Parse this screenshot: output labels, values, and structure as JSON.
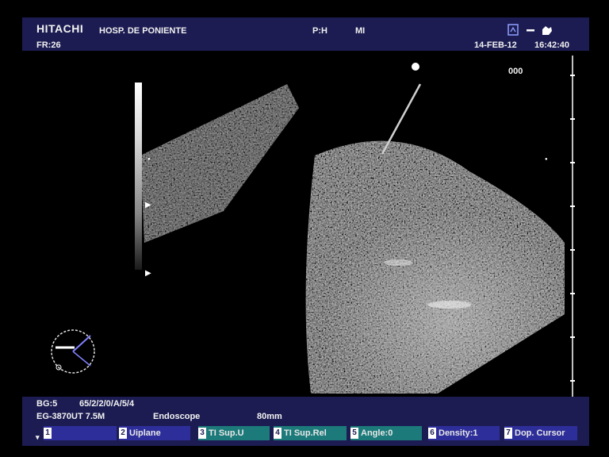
{
  "header": {
    "brand": "HITACHI",
    "hospital": "HOSP. DE PONIENTE",
    "frame_rate": "FR:26",
    "probe_label": "P:H",
    "mi_label": "MI",
    "date": "14-FEB-12",
    "time": "16:42:40",
    "counter": "000"
  },
  "footer": {
    "gain": "BG:5",
    "params": "65/2/2/0/A/5/4",
    "probe": "EG-3870UT 7.5M",
    "mode": "Endoscope",
    "depth": "80mm"
  },
  "function_buttons": [
    {
      "num": "1",
      "label": "",
      "style": "blue"
    },
    {
      "num": "2",
      "label": "Uiplane",
      "style": "blue"
    },
    {
      "num": "3",
      "label": "TI Sup.U",
      "style": "teal"
    },
    {
      "num": "4",
      "label": "TI Sup.Rel",
      "style": "teal"
    },
    {
      "num": "5",
      "label": "Angle:0",
      "style": "teal"
    },
    {
      "num": "6",
      "label": "Density:1",
      "style": "blue"
    },
    {
      "num": "7",
      "label": "Dop. Cursor",
      "style": "blue"
    }
  ],
  "colors": {
    "panel": "#1c1c52",
    "button_blue": "#2e2e9a",
    "button_teal": "#1c7a7a"
  }
}
